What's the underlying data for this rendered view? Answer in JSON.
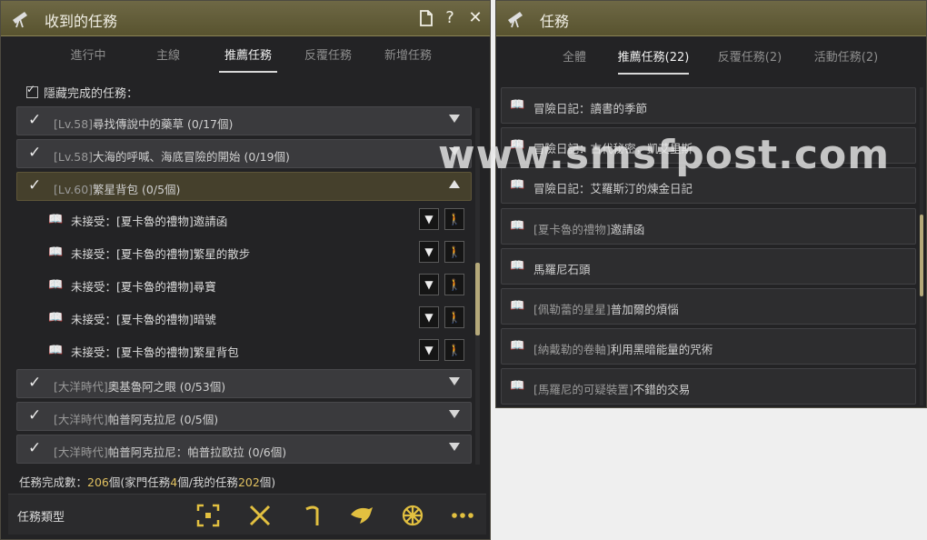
{
  "left": {
    "title": "收到的任務",
    "header_buttons": {
      "help": "?",
      "close": "✕"
    },
    "tabs": [
      "進行中",
      "主線",
      "推薦任務",
      "反覆任務",
      "新增任務"
    ],
    "hide_completed_label": "隱藏完成的任務：",
    "quests": [
      {
        "tag": "[Lv.58]",
        "name": "尋找傳說中的藥草",
        "count": "(0/17個)",
        "expanded": false
      },
      {
        "tag": "[Lv.58]",
        "name": "大海的呼喊、海底冒險的開始",
        "count": "(0/19個)",
        "expanded": false
      },
      {
        "tag": "[Lv.60]",
        "name": "繁星背包",
        "count": "(0/5個)",
        "expanded": true
      },
      {
        "tag": "[大洋時代]",
        "name": "奧基魯阿之眼",
        "count": "(0/53個)",
        "expanded": false
      },
      {
        "tag": "[大洋時代]",
        "name": "帕普阿克拉尼",
        "count": "(0/5個)",
        "expanded": false
      },
      {
        "tag": "[大洋時代]",
        "name": "帕普阿克拉尼：帕普拉歐拉",
        "count": "(0/6個)",
        "expanded": false
      }
    ],
    "subquests": [
      "未接受：[夏卡魯的禮物]邀請函",
      "未接受：[夏卡魯的禮物]繁星的散步",
      "未接受：[夏卡魯的禮物]尋寶",
      "未接受：[夏卡魯的禮物]暗號",
      "未接受：[夏卡魯的禮物]繁星背包"
    ],
    "summary": {
      "label": "任務完成數：",
      "total": "206",
      "unit": "個(家門任務",
      "family": "4",
      "mid": "個/我的任務",
      "mine": "202",
      "end": "個)"
    },
    "bottom_label": "任務類型"
  },
  "right": {
    "title": "任務",
    "tabs": [
      "全體",
      "推薦任務(22)",
      "反覆任務(2)",
      "活動任務(2)"
    ],
    "items": [
      {
        "tag": "",
        "name": "冒險日記：讀書的季節"
      },
      {
        "tag": "",
        "name": "冒險日記：古代秘密，凱艾里斯"
      },
      {
        "tag": "",
        "name": "冒險日記：艾羅斯汀的煉金日記"
      },
      {
        "tag": "[夏卡魯的禮物]",
        "name": "邀請函"
      },
      {
        "tag": "",
        "name": "馬羅尼石頭"
      },
      {
        "tag": "[佩勒蕾的星星]",
        "name": "普加爾的煩惱"
      },
      {
        "tag": "[納戴勒的卷軸]",
        "name": "利用黑暗能量的咒術"
      },
      {
        "tag": "[馬羅尼的可疑裝置]",
        "name": "不錯的交易"
      }
    ]
  },
  "watermark": "www.smsfpost.com",
  "colors": {
    "title_bar": "#5f5936",
    "panel": "#232325",
    "accent_gold": "#e2c040"
  }
}
